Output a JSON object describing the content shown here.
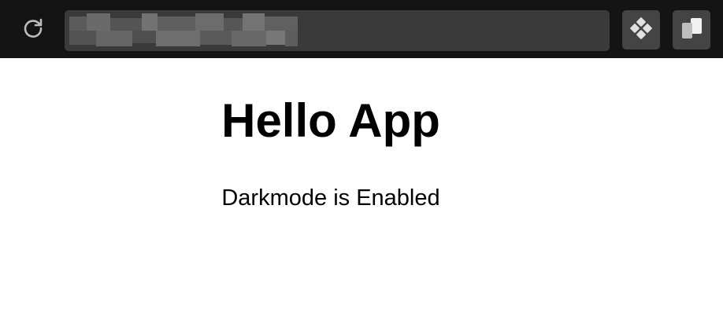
{
  "browser": {
    "reload_icon": "reload-icon",
    "address_bar": {
      "value": "",
      "obscured": true
    },
    "extensions": [
      {
        "icon": "diamond-grid-icon"
      },
      {
        "icon": "copy-pages-icon"
      }
    ]
  },
  "page": {
    "heading": "Hello App",
    "status": "Darkmode is Enabled"
  }
}
